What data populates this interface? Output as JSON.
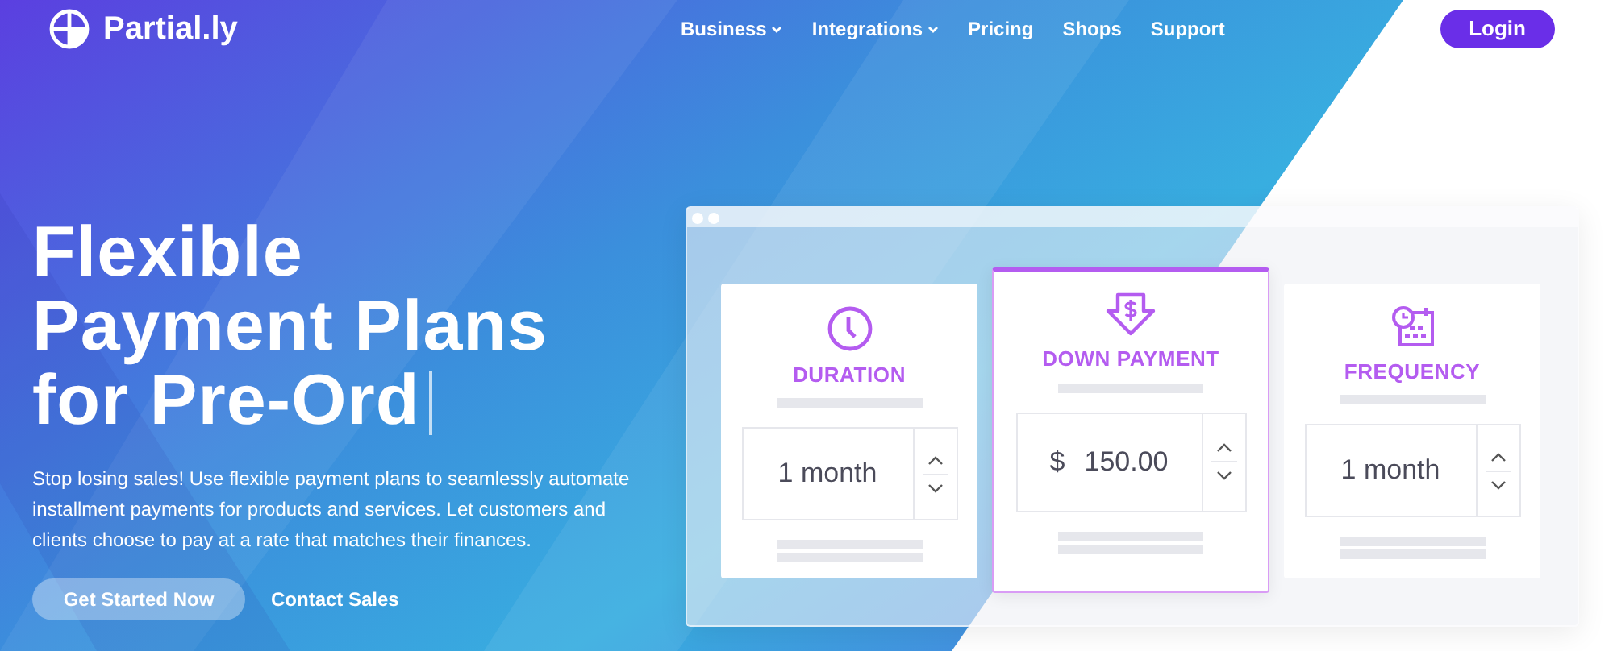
{
  "brand": {
    "name": "Partial.ly"
  },
  "nav": [
    {
      "label": "Business",
      "dropdown": true
    },
    {
      "label": "Integrations",
      "dropdown": true
    },
    {
      "label": "Pricing",
      "dropdown": false
    },
    {
      "label": "Shops",
      "dropdown": false
    },
    {
      "label": "Support",
      "dropdown": false
    }
  ],
  "login": "Login",
  "hero": {
    "headline_lines": [
      "Flexible",
      "Payment Plans",
      "for Pre-Ord"
    ],
    "description": "Stop losing sales! Use flexible payment plans to seamlessly automate installment payments for products and services. Let customers and clients choose to pay at a rate that matches their finances.",
    "buttons": [
      {
        "label": "Get Started Now",
        "kind": "primary"
      },
      {
        "label": "Contact Sales",
        "kind": "link"
      }
    ]
  },
  "cards": [
    {
      "kind": "clock",
      "title": "DURATION",
      "value": "1 month",
      "selected": false
    },
    {
      "kind": "money",
      "title": "DOWN PAYMENT",
      "prefix": "$",
      "value": "150.00",
      "selected": true
    },
    {
      "kind": "calendar",
      "title": "FREQUENCY",
      "value": "1 month",
      "selected": false
    }
  ]
}
